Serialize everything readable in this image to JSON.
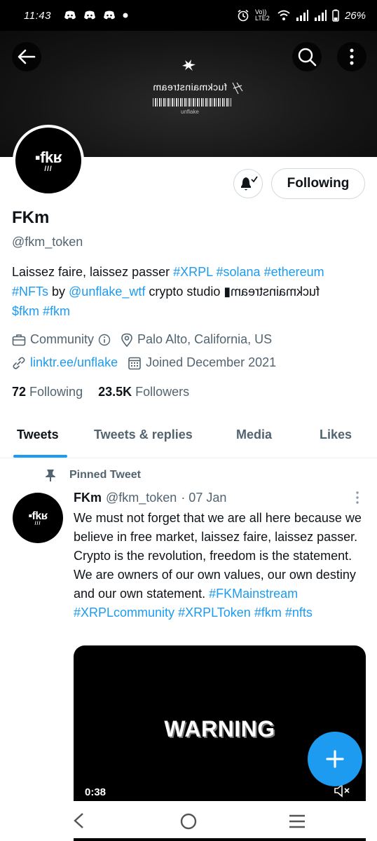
{
  "status_bar": {
    "time": "11:43",
    "network": "Vo)) LTE2",
    "battery": "26%"
  },
  "banner": {
    "text": "fuckmainstream",
    "brand": "unflake"
  },
  "profile": {
    "avatar_logo": "fk",
    "avatar_sub": "///",
    "following_button": "Following",
    "name": "FKm",
    "handle": "@fkm_token",
    "bio": {
      "text1": "Laissez faire, laissez passer ",
      "tag1": "#XRPL",
      "tag2": "#solana",
      "tag3": "#ethereum",
      "tag4": "#NFTs",
      "by": " by ",
      "mention": "@unflake_wtf",
      "studio": " crypto studio ▮",
      "mirror": "fuckmainstream",
      "cash1": "$fkm",
      "tag5": "#fkm"
    },
    "category": "Community",
    "location": "Palo Alto, California, US",
    "website": "linktr.ee/unflake",
    "joined": "Joined December 2021",
    "following_count": "72",
    "following_label": "Following",
    "followers_count": "23.5K",
    "followers_label": "Followers"
  },
  "tabs": [
    "Tweets",
    "Tweets & replies",
    "Media",
    "Likes"
  ],
  "tweet": {
    "pinned_label": "Pinned Tweet",
    "author_name": "FKm",
    "author_handle": "@fkm_token",
    "date": "· 07 Jan",
    "text": "We must not forget that we are all here because we believe in free market, laissez faire, laissez passer. Crypto is the revolution, freedom is the statement. We are owners of our own values, our own destiny and our own statement. ",
    "tags": [
      "#FKMainstream",
      "#XRPLcommunity",
      "#XRPLToken",
      "#fkm",
      "#nfts"
    ],
    "media_text": "WARNING",
    "duration": "0:38"
  },
  "colors": {
    "accent": "#1d9bf0",
    "text": "#0f1419",
    "muted": "#536471"
  }
}
